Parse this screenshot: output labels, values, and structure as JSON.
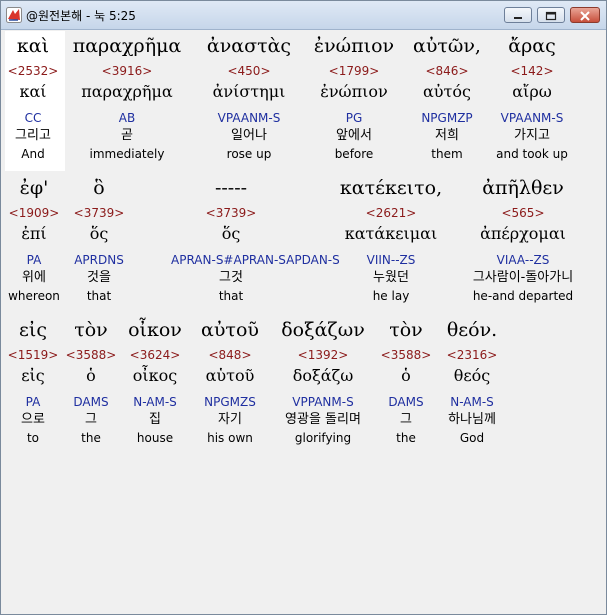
{
  "window": {
    "title": "@원전본해 - 눅 5:25"
  },
  "rows": [
    {
      "words": [
        {
          "greek": "καὶ",
          "strong": "<2532>",
          "lemma": "καί",
          "parse": "CC",
          "korean": "그리고",
          "english": "And"
        },
        {
          "greek": "παραχρῆμα",
          "strong": "<3916>",
          "lemma": "παραχρῆμα",
          "parse": "AB",
          "korean": "곧",
          "english": "immediately"
        },
        {
          "greek": "ἀναστὰς",
          "strong": "<450>",
          "lemma": "ἀνίστημι",
          "parse": "VPAANM-S",
          "korean": "일어나",
          "english": "rose up"
        },
        {
          "greek": "ἐνώπιον",
          "strong": "<1799>",
          "lemma": "ἐνώπιον",
          "parse": "PG",
          "korean": "앞에서",
          "english": "before"
        },
        {
          "greek": "αὐτῶν,",
          "strong": "<846>",
          "lemma": "αὐτός",
          "parse": "NPGMZP",
          "korean": "저희",
          "english": "them"
        },
        {
          "greek": "ἄρας",
          "strong": "<142>",
          "lemma": "αἴρω",
          "parse": "VPAANM-S",
          "korean": "가지고",
          "english": "and took up"
        }
      ]
    },
    {
      "words": [
        {
          "greek": "ἐφ'",
          "strong": "<1909>",
          "lemma": "ἐπί",
          "parse": "PA",
          "korean": "위에",
          "english": "whereon"
        },
        {
          "greek": "ὃ",
          "strong": "<3739>",
          "lemma": "ὅς",
          "parse": "APRDNS",
          "korean": "것을",
          "english": "that"
        },
        {
          "greek": "-----",
          "strong": "<3739>",
          "lemma": "ὅς",
          "parse": "APRAN-S#APRAN-SAPDAN-S",
          "korean": "그것",
          "english": "that"
        },
        {
          "greek": "κατέκειτο,",
          "strong": "<2621>",
          "lemma": "κατάκειμαι",
          "parse": "VIIN--ZS",
          "korean": "누웠던",
          "english": "he lay"
        },
        {
          "greek": "ἀπῆλθεν",
          "strong": "<565>",
          "lemma": "ἀπέρχομαι",
          "parse": "VIAA--ZS",
          "korean": "그사람이-돌아가니",
          "english": "he-and departed"
        }
      ]
    },
    {
      "words": [
        {
          "greek": "εἰς",
          "strong": "<1519>",
          "lemma": "εἰς",
          "parse": "PA",
          "korean": "으로",
          "english": "to"
        },
        {
          "greek": "τὸν",
          "strong": "<3588>",
          "lemma": "ὁ",
          "parse": "DAMS",
          "korean": "그",
          "english": "the"
        },
        {
          "greek": "οἶκον",
          "strong": "<3624>",
          "lemma": "οἶκος",
          "parse": "N-AM-S",
          "korean": "집",
          "english": "house"
        },
        {
          "greek": "αὐτοῦ",
          "strong": "<848>",
          "lemma": "αὑτοῦ",
          "parse": "NPGMZS",
          "korean": "자기",
          "english": "his own"
        },
        {
          "greek": "δοξάζων",
          "strong": "<1392>",
          "lemma": "δοξάζω",
          "parse": "VPPANM-S",
          "korean": "영광을 돌리며",
          "english": "glorifying"
        },
        {
          "greek": "τὸν",
          "strong": "<3588>",
          "lemma": "ὁ",
          "parse": "DAMS",
          "korean": "그",
          "english": "the"
        },
        {
          "greek": "θεόν.",
          "strong": "<2316>",
          "lemma": "θεός",
          "parse": "N-AM-S",
          "korean": "하나님께",
          "english": "God"
        }
      ]
    }
  ]
}
